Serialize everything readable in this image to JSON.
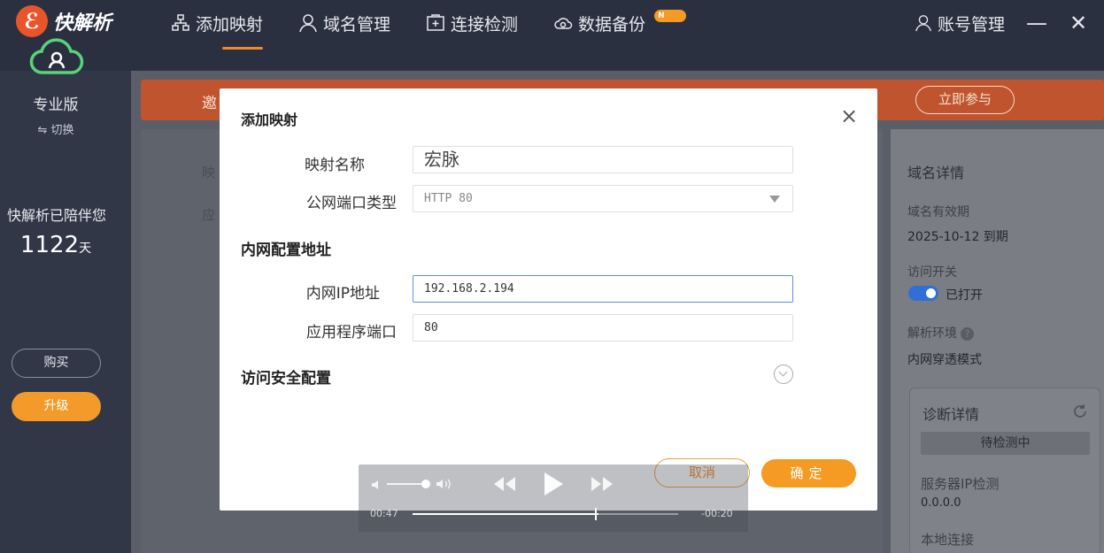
{
  "app": {
    "name": "快解析",
    "logo_mark": "ℰ"
  },
  "nav": {
    "items": [
      {
        "label": "添加映射",
        "icon": "sitemap-icon",
        "active": true
      },
      {
        "label": "域名管理",
        "icon": "user-icon"
      },
      {
        "label": "连接检测",
        "icon": "plus-box-icon"
      },
      {
        "label": "数据备份",
        "icon": "cloud-icon",
        "badge": "N"
      }
    ],
    "account": "账号管理",
    "minimize": "—",
    "close": "✕"
  },
  "sidebar": {
    "edition": "专业版",
    "switch_label": "⇋ 切换",
    "companion": "快解析已陪伴您",
    "days": "1122",
    "days_unit": "天",
    "buy_label": "购买",
    "upgrade_label": "升级"
  },
  "banner": {
    "text": "邀",
    "join_label": "立即参与"
  },
  "background_form": {
    "label1": "映",
    "label2": "应"
  },
  "right_panel": {
    "title": "域名详情",
    "validity_label": "域名有效期",
    "validity_value": "2025-10-12 到期",
    "access_label": "访问开关",
    "access_value": "已打开",
    "env_label": "解析环境",
    "env_value": "内网穿透模式",
    "diag_title": "诊断详情",
    "diag_status": "待检测中",
    "server_ip_label": "服务器IP检测",
    "server_ip_value": "0.0.0.0",
    "local_conn_label": "本地连接"
  },
  "modal": {
    "title": "添加映射",
    "close": "×",
    "mapping_name_label": "映射名称",
    "mapping_name_value": "宏脉",
    "port_type_label": "公网端口类型",
    "port_type_value": "HTTP 80",
    "intranet_section": "内网配置地址",
    "ip_label": "内网IP地址",
    "ip_value": "192.168.2.194",
    "app_port_label": "应用程序端口",
    "app_port_value": "80",
    "security_section": "访问安全配置",
    "cancel_label": "取消",
    "ok_label": "确定"
  },
  "video": {
    "current_time": "00:47",
    "remaining_time": "-00:20",
    "progress": 0.7
  }
}
